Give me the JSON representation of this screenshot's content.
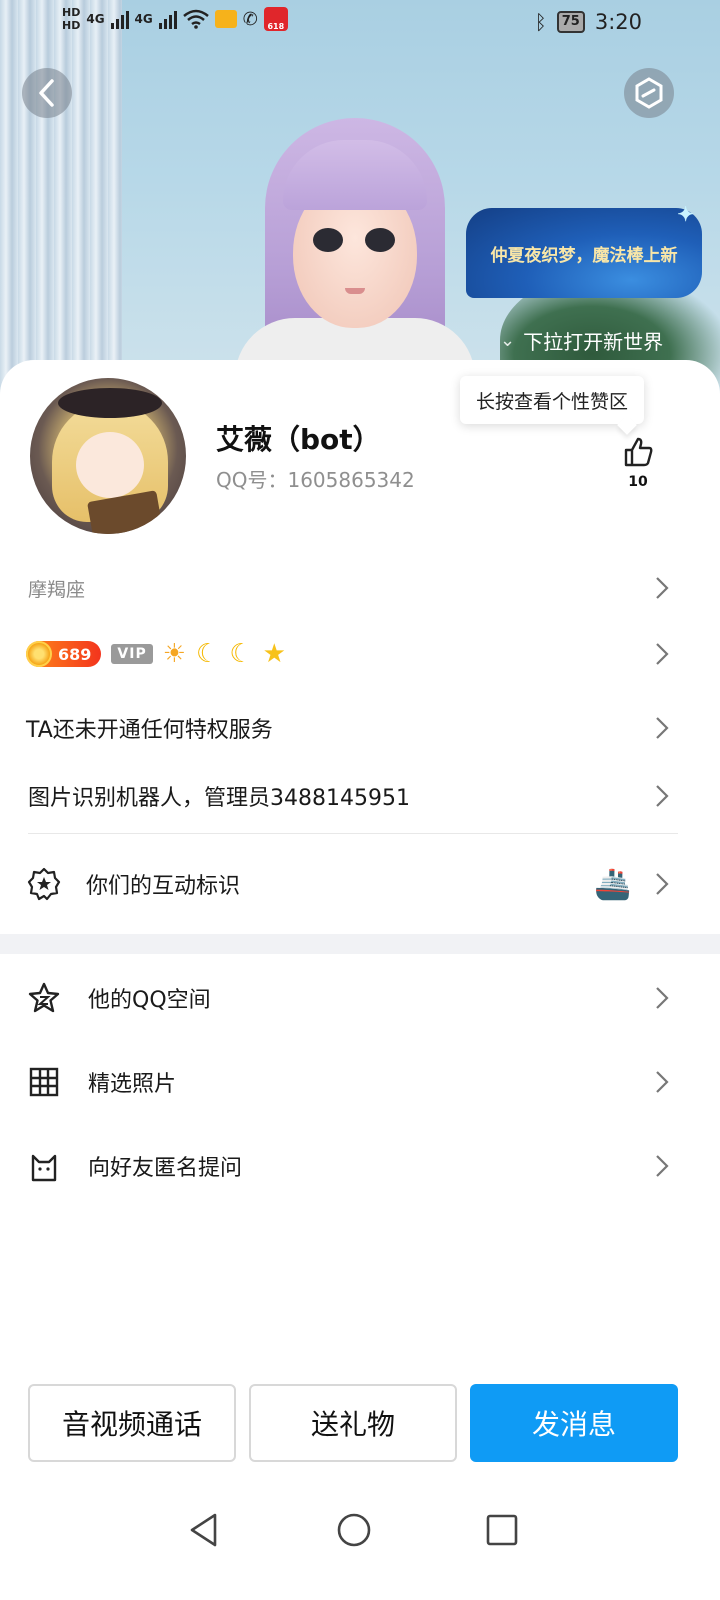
{
  "status_bar": {
    "hd1": "HD",
    "hd2": "HD",
    "net1": "4G",
    "net2": "4G",
    "app_badge": "618",
    "battery": "75",
    "time": "3:20"
  },
  "hero": {
    "banner_text": "仲夏夜织梦，魔法棒上新",
    "pull_hint": "下拉打开新世界"
  },
  "profile": {
    "nickname": "艾薇（bot）",
    "qq_number": "QQ号：1605865342",
    "like_tooltip": "长按查看个性赞区",
    "like_count": "10"
  },
  "info": {
    "constellation": "摩羯座",
    "coin_value": "689",
    "vip_label": "VIP",
    "level_icons": [
      "☀",
      "☾",
      "☾",
      "★"
    ],
    "privilege": "TA还未开通任何特权服务",
    "signature": "图片识别机器人，管理员3488145951",
    "interaction": "你们的互动标识"
  },
  "menu": {
    "qzone": "他的QQ空间",
    "photos": "精选照片",
    "anon_question": "向好友匿名提问"
  },
  "actions": {
    "call": "音视频通话",
    "gift": "送礼物",
    "message": "发消息"
  },
  "colors": {
    "primary": "#0f9bf5",
    "coin": "#f3341d",
    "divider": "#f1f2f5"
  }
}
